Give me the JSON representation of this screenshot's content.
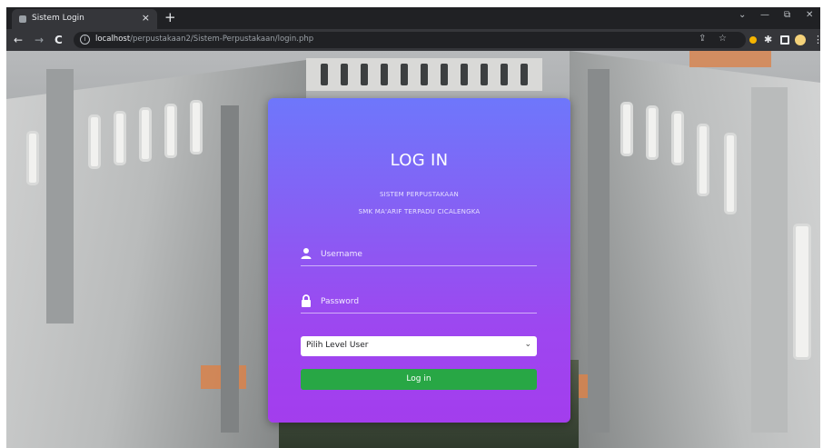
{
  "browser": {
    "tab_title": "Sistem Login",
    "tab_close": "×",
    "new_tab": "+",
    "window_controls": {
      "chevron": "⌄",
      "minimize": "—",
      "restore": "⧉",
      "close": "✕"
    },
    "nav": {
      "back": "←",
      "forward": "→",
      "reload": "C"
    },
    "address": {
      "host": "localhost",
      "path": "/perpustakaan2/Sistem-Perpustakaan/login.php"
    },
    "icons": [
      "share-icon",
      "bookmark-star-icon",
      "extension-icon",
      "puzzle-icon",
      "sidepanel-icon",
      "profile-avatar-icon",
      "menu-icon"
    ]
  },
  "login": {
    "title": "LOG IN",
    "subtitle_line1": "SISTEM PERPUSTAKAAN",
    "subtitle_line2": "SMK MA'ARIF TERPADU CICALENGKA",
    "username_placeholder": "Username",
    "password_placeholder": "Password",
    "level_select": {
      "selected": "Pilih Level User"
    },
    "submit_label": "Log in"
  },
  "colors": {
    "card_gradient_top": "#6e77fb",
    "card_gradient_bottom": "#a33ded",
    "submit_button": "#28a745"
  }
}
